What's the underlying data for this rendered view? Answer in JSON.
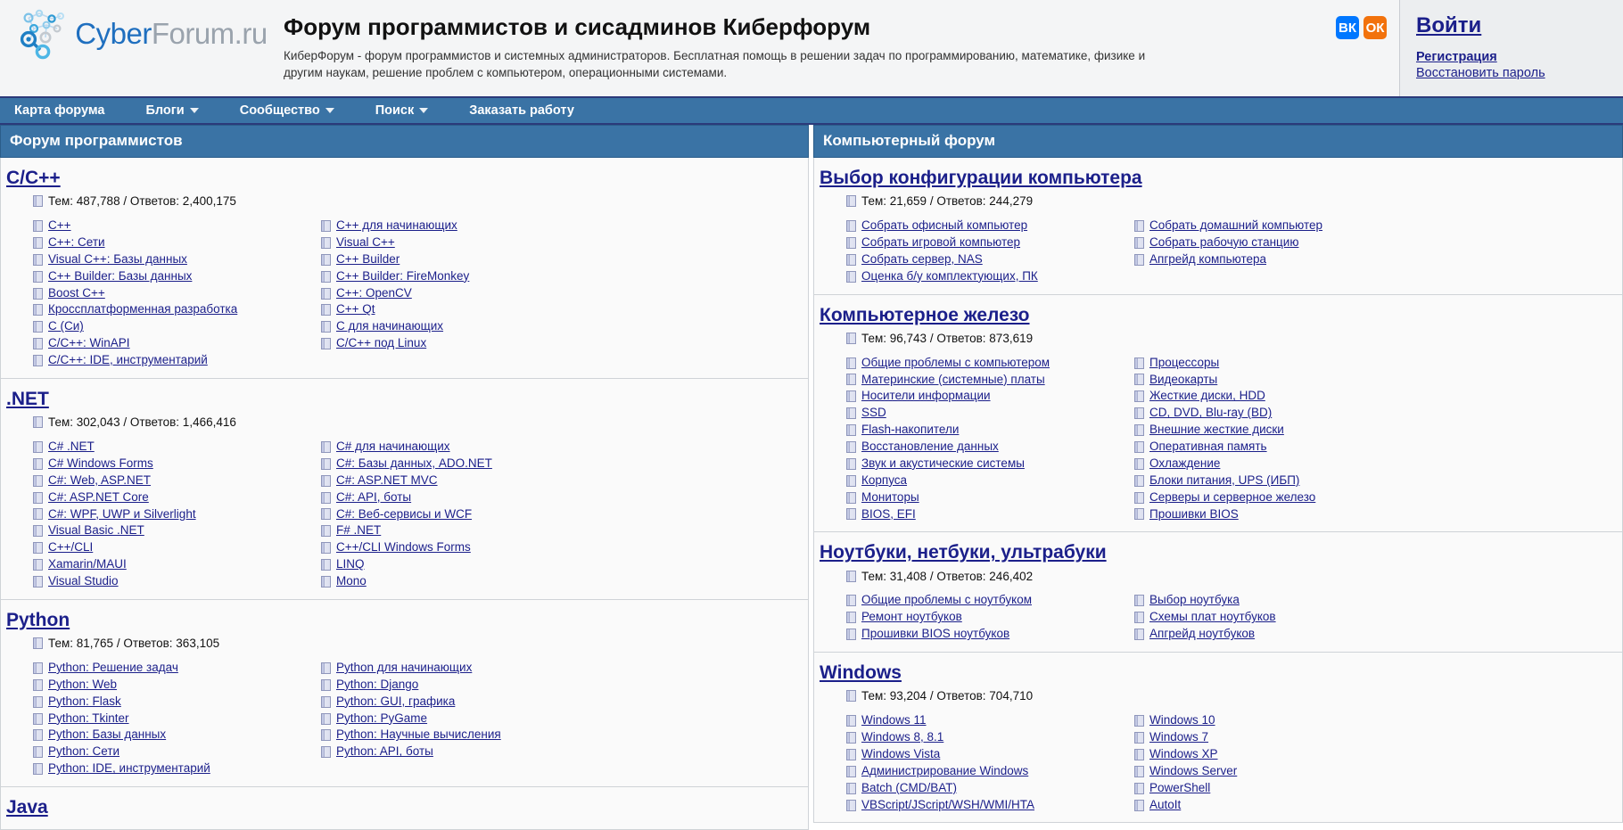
{
  "header": {
    "logo": {
      "cyber": "Cyber",
      "forum": "Forum",
      "ru": ".ru",
      "icon": "network-nodes-logo"
    },
    "title": "Форум программистов и сисадминов Киберфорум",
    "description": "КиберФорум - форум программистов и системных администраторов. Бесплатная помощь в решении задач по программированию, математике, физике и другим наукам, решение проблем с компьютером, операционными системами.",
    "social": [
      {
        "name": "vk",
        "glyph": "ВК",
        "color": "#0077ff"
      },
      {
        "name": "ok",
        "glyph": "ОК",
        "color": "#f2720c"
      }
    ],
    "login": "Войти",
    "register": "Регистрация",
    "recover": "Восстановить пароль"
  },
  "nav": [
    {
      "label": "Карта форума",
      "caret": false
    },
    {
      "label": "Блоги",
      "caret": true
    },
    {
      "label": "Сообщество",
      "caret": true
    },
    {
      "label": "Поиск",
      "caret": true
    },
    {
      "label": "Заказать работу",
      "caret": false
    }
  ],
  "columns": [
    {
      "header": "Форум программистов",
      "blocks": [
        {
          "title": "C/C++",
          "stats": "Тем: 487,788 / Ответов: 2,400,175",
          "left": [
            "C++",
            "C++: Сети",
            "Visual C++: Базы данных",
            "C++ Builder: Базы данных",
            "Boost C++",
            "Кроссплатформенная разработка",
            "C (Си)",
            "C/C++: WinAPI",
            "C/C++: IDE, инструментарий"
          ],
          "right": [
            "C++ для начинающих",
            "Visual C++",
            "C++ Builder",
            "C++ Builder: FireMonkey",
            "C++: OpenCV",
            "C++ Qt",
            "C для начинающих",
            "C/C++ под Linux"
          ]
        },
        {
          "title": ".NET",
          "stats": "Тем: 302,043 / Ответов: 1,466,416",
          "left": [
            "C# .NET",
            "C# Windows Forms",
            "C#: Web, ASP.NET",
            "C#: ASP.NET Core",
            "C#: WPF, UWP и Silverlight",
            "Visual Basic .NET",
            "C++/CLI",
            "Xamarin/MAUI",
            "Visual Studio"
          ],
          "right": [
            "C# для начинающих",
            "C#: Базы данных, ADO.NET",
            "C#: ASP.NET MVC",
            "C#: API, боты",
            "C#: Веб-сервисы и WCF",
            "F# .NET",
            "C++/CLI Windows Forms",
            "LINQ",
            "Mono"
          ]
        },
        {
          "title": "Python",
          "stats": "Тем: 81,765 / Ответов: 363,105",
          "left": [
            "Python: Решение задач",
            "Python: Web",
            "Python: Flask",
            "Python: Tkinter",
            "Python: Базы данных",
            "Python: Сети",
            "Python: IDE, инструментарий"
          ],
          "right": [
            "Python для начинающих",
            "Python: Django",
            "Python: GUI, графика",
            "Python: PyGame",
            "Python: Научные вычисления",
            "Python: API, боты"
          ]
        },
        {
          "title": "Java",
          "stats": "",
          "left": [],
          "right": []
        }
      ]
    },
    {
      "header": "Компьютерный форум",
      "blocks": [
        {
          "title": "Выбор конфигурации компьютера",
          "stats": "Тем: 21,659 / Ответов: 244,279",
          "left": [
            "Собрать офисный компьютер",
            "Собрать игровой компьютер",
            "Собрать сервер, NAS",
            "Оценка б/у комплектующих, ПК"
          ],
          "right": [
            "Собрать домашний компьютер",
            "Собрать рабочую станцию",
            "Апгрейд компьютера"
          ]
        },
        {
          "title": "Компьютерное железо",
          "stats": "Тем: 96,743 / Ответов: 873,619",
          "left": [
            "Общие проблемы с компьютером",
            "Материнские (системные) платы",
            "Носители информации",
            "SSD",
            "Flash-накопители",
            "Восстановление данных",
            "Звук и акустические системы",
            "Корпуса",
            "Мониторы",
            "BIOS, EFI"
          ],
          "right": [
            "Процессоры",
            "Видеокарты",
            "Жесткие диски, HDD",
            "CD, DVD, Blu-ray (BD)",
            "Внешние жесткие диски",
            "Оперативная память",
            "Охлаждение",
            "Блоки питания, UPS (ИБП)",
            "Серверы и серверное железо",
            "Прошивки BIOS"
          ]
        },
        {
          "title": "Ноутбуки, нетбуки, ультрабуки",
          "stats": "Тем: 31,408 / Ответов: 246,402",
          "left": [
            "Общие проблемы с ноутбуком",
            "Ремонт ноутбуков",
            "Прошивки BIOS ноутбуков"
          ],
          "right": [
            "Выбор ноутбука",
            "Схемы плат ноутбуков",
            "Апгрейд ноутбуков"
          ]
        },
        {
          "title": "Windows",
          "stats": "Тем: 93,204 / Ответов: 704,710",
          "left": [
            "Windows 11",
            "Windows 8, 8.1",
            "Windows Vista",
            "Администрирование Windows",
            "Batch (CMD/BAT)",
            "VBScript/JScript/WSH/WMI/HTA"
          ],
          "right": [
            "Windows 10",
            "Windows 7",
            "Windows XP",
            "Windows Server",
            "PowerShell",
            "AutoIt"
          ]
        }
      ]
    }
  ],
  "colors": {
    "nav_bg": "#3a73a5",
    "header_bar": "#3a73a5",
    "link": "#1b1f8a",
    "page_bg": "#fafafa"
  }
}
